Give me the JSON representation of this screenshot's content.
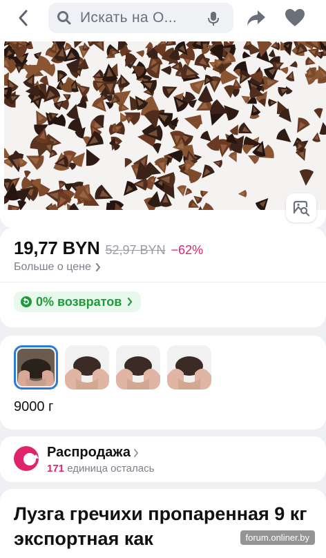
{
  "header": {
    "search_placeholder": "Искать на О..."
  },
  "icons": {
    "back": "chevron-left-icon",
    "search": "search-icon",
    "mic": "microphone-icon",
    "share": "share-icon",
    "favorite": "heart-icon",
    "image_search": "image-search-icon"
  },
  "price": {
    "current": "19,77 BYN",
    "old": "52,97 BYN",
    "discount": "−62%",
    "more_link": "Больше о цене"
  },
  "returns_badge": {
    "label": "0% возвратов"
  },
  "variants": {
    "selected_label": "9000 г",
    "count": 4,
    "selected_index": 0
  },
  "sale": {
    "title": "Распродажа",
    "stock_count": "171",
    "stock_text": "единица осталась"
  },
  "product": {
    "title": "Лузга гречихи пропаренная 9 кг экспортная как"
  },
  "watermark": "forum.onliner.by",
  "colors": {
    "accent_pink": "#e0246b",
    "green": "#1f9a3a",
    "selected_blue": "#2a7bd6",
    "icon_gray": "#6b6f7a"
  }
}
